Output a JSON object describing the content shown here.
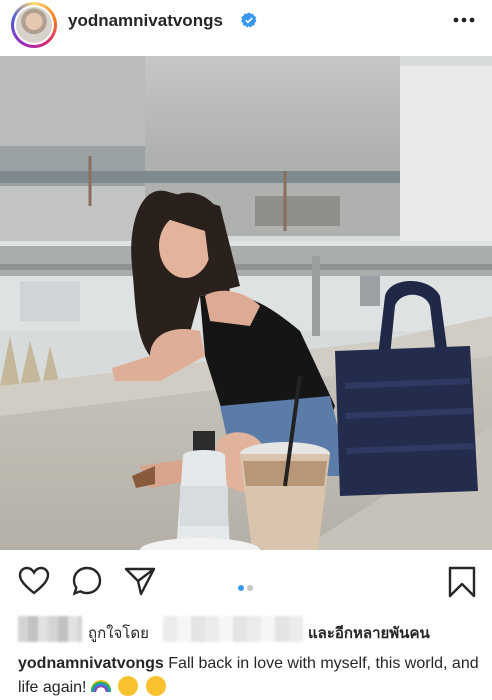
{
  "post": {
    "username": "yodnamnivatvongs",
    "verified": true,
    "more_icon": "more-horizontal-icon"
  },
  "photo": {
    "description_icon": "photo"
  },
  "actions": {
    "like_icon": "heart-icon",
    "comment_icon": "comment-icon",
    "share_icon": "send-icon",
    "save_icon": "bookmark-icon",
    "carousel_count": 2,
    "carousel_active": 1,
    "active_dot_color": "#3897f0",
    "inactive_dot_color": "#c7c7c7"
  },
  "likes": {
    "prefix": "ถูกใจโดย",
    "suffix": "และอีกหลายพันคน"
  },
  "caption": {
    "username": "yodnamnivatvongs",
    "text": "Fall back in love with myself, this world, and life again!",
    "emojis": [
      "rainbow",
      "smiling-face",
      "upside-down-face"
    ]
  }
}
